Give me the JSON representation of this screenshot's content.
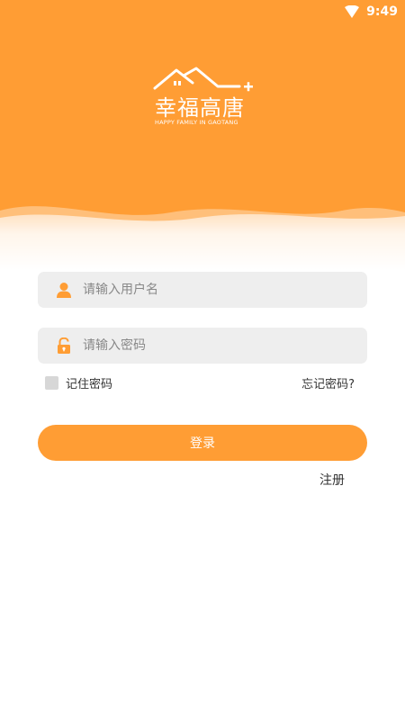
{
  "status_bar": {
    "time": "9:49"
  },
  "logo": {
    "title": "幸福高唐",
    "subtitle": "HAPPY FAMILY IN GAOTANG"
  },
  "form": {
    "username_placeholder": "请输入用户名",
    "password_placeholder": "请输入密码",
    "remember_label": "记住密码",
    "forgot_label": "忘记密码?",
    "login_label": "登录",
    "register_label": "注册"
  },
  "icons": {
    "user": "user-icon",
    "lock": "lock-icon",
    "wifi": "wifi-icon",
    "house_logo": "house-logo-icon"
  },
  "colors": {
    "accent": "#ff9d34",
    "field_bg": "#eeeeee",
    "text": "#333333",
    "placeholder": "#888888"
  }
}
